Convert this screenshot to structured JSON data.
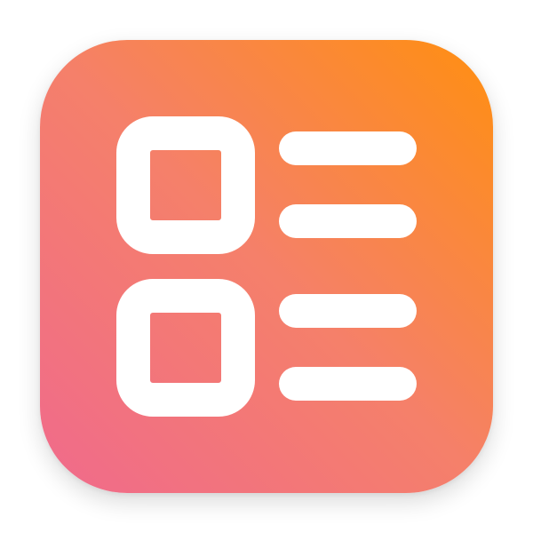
{
  "app_icon": {
    "icon_name": "checklist-icon",
    "gradient": {
      "bottom_left": "#F06A8C",
      "middle": "#F5806A",
      "top_right": "#FF8F10"
    },
    "glyph_color": "#FFFFFF"
  }
}
